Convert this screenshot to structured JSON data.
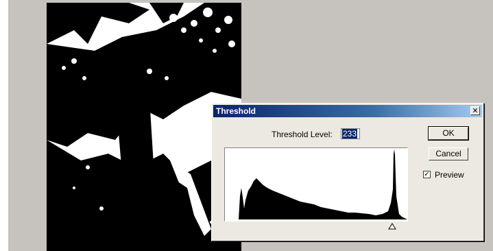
{
  "dialog": {
    "title": "Threshold",
    "close_glyph": "✕",
    "threshold_label": "Threshold Level:",
    "threshold_value": "233",
    "ok_label": "OK",
    "cancel_label": "Cancel",
    "preview_label": "Preview",
    "preview_checked": true,
    "slider_fraction": 0.914
  },
  "icons": [
    "close-icon",
    "checkbox-check-icon",
    "slider-triangle-icon"
  ],
  "colors": {
    "titlebar_start": "#0a246a",
    "titlebar_end": "#a6caf0",
    "dialog_bg": "#ece9e2",
    "workspace_bg": "#c6c3bf"
  }
}
